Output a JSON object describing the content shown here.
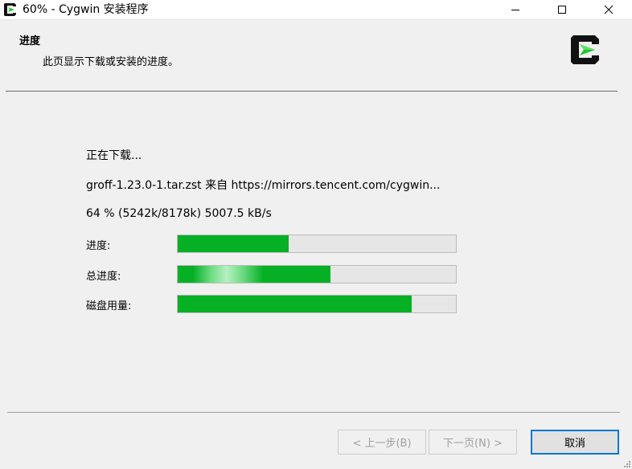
{
  "window": {
    "title": "60% - Cygwin 安装程序"
  },
  "icons": {
    "app": "cygwin-icon",
    "minimize": "minimize-icon",
    "maximize": "maximize-icon",
    "close": "close-icon",
    "logo": "cygwin-logo"
  },
  "header": {
    "title": "进度",
    "subtitle": "此页显示下载或安装的进度。"
  },
  "progress": {
    "status": "正在下载...",
    "file_line": "groff-1.23.0-1.tar.zst 来自 https://mirrors.tencent.com/cygwin...",
    "stats_line": "64 %  (5242k/8178k)  5007.5 kB/s",
    "rows": [
      {
        "label": "进度:",
        "value": 0.4
      },
      {
        "label": "总进度:",
        "value": 0.55
      },
      {
        "label": "磁盘用量:",
        "value": 0.84
      }
    ]
  },
  "buttons": {
    "back": "< 上一步(B)",
    "next": "下一页(N) >",
    "cancel": "取消"
  },
  "colors": {
    "progress_fill": "#06b025",
    "progress_track": "#e6e6e6",
    "focus_border": "#0078d7"
  }
}
